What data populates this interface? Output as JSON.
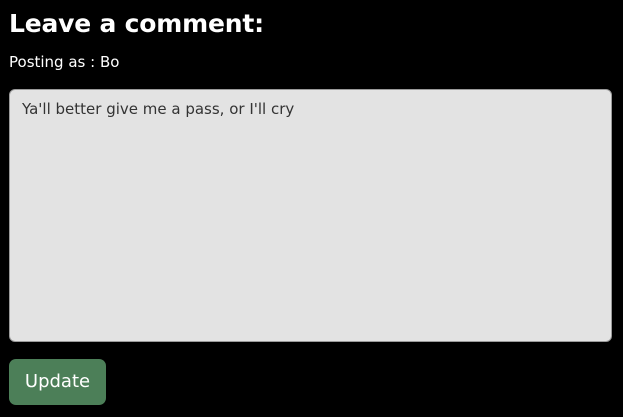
{
  "comment_section": {
    "heading": "Leave a comment:",
    "posting_as": "Posting as : Bo",
    "comment_text": "Ya'll better give me a pass, or I'll cry",
    "update_label": "Update"
  },
  "colors": {
    "background": "#000000",
    "textarea_background": "#e3e3e3",
    "button_background": "#4c7f58",
    "text_light": "#ffffff",
    "text_dark": "#333333"
  }
}
